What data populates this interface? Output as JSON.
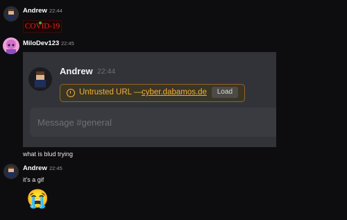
{
  "messages": [
    {
      "username": "Andrew",
      "time": "22:44"
    },
    {
      "username": "MiloDev123",
      "time": "22:45"
    },
    {
      "username": "Andrew",
      "time": "22:45"
    }
  ],
  "covid_image": {
    "text": "COVID-19"
  },
  "embed": {
    "username": "Andrew",
    "time": "22:44",
    "warning_label": "Untrusted URL —",
    "warning_link": "cyber.dabamos.de",
    "load_label": "Load",
    "composer_placeholder": "Message #general"
  },
  "msg_text_1": "what is blud trying",
  "msg_text_2": "it's a gif",
  "emoji": "😭",
  "colors": {
    "background": "#0d0d0f",
    "warning": "#f0b232",
    "covid_red": "#e8231a"
  }
}
